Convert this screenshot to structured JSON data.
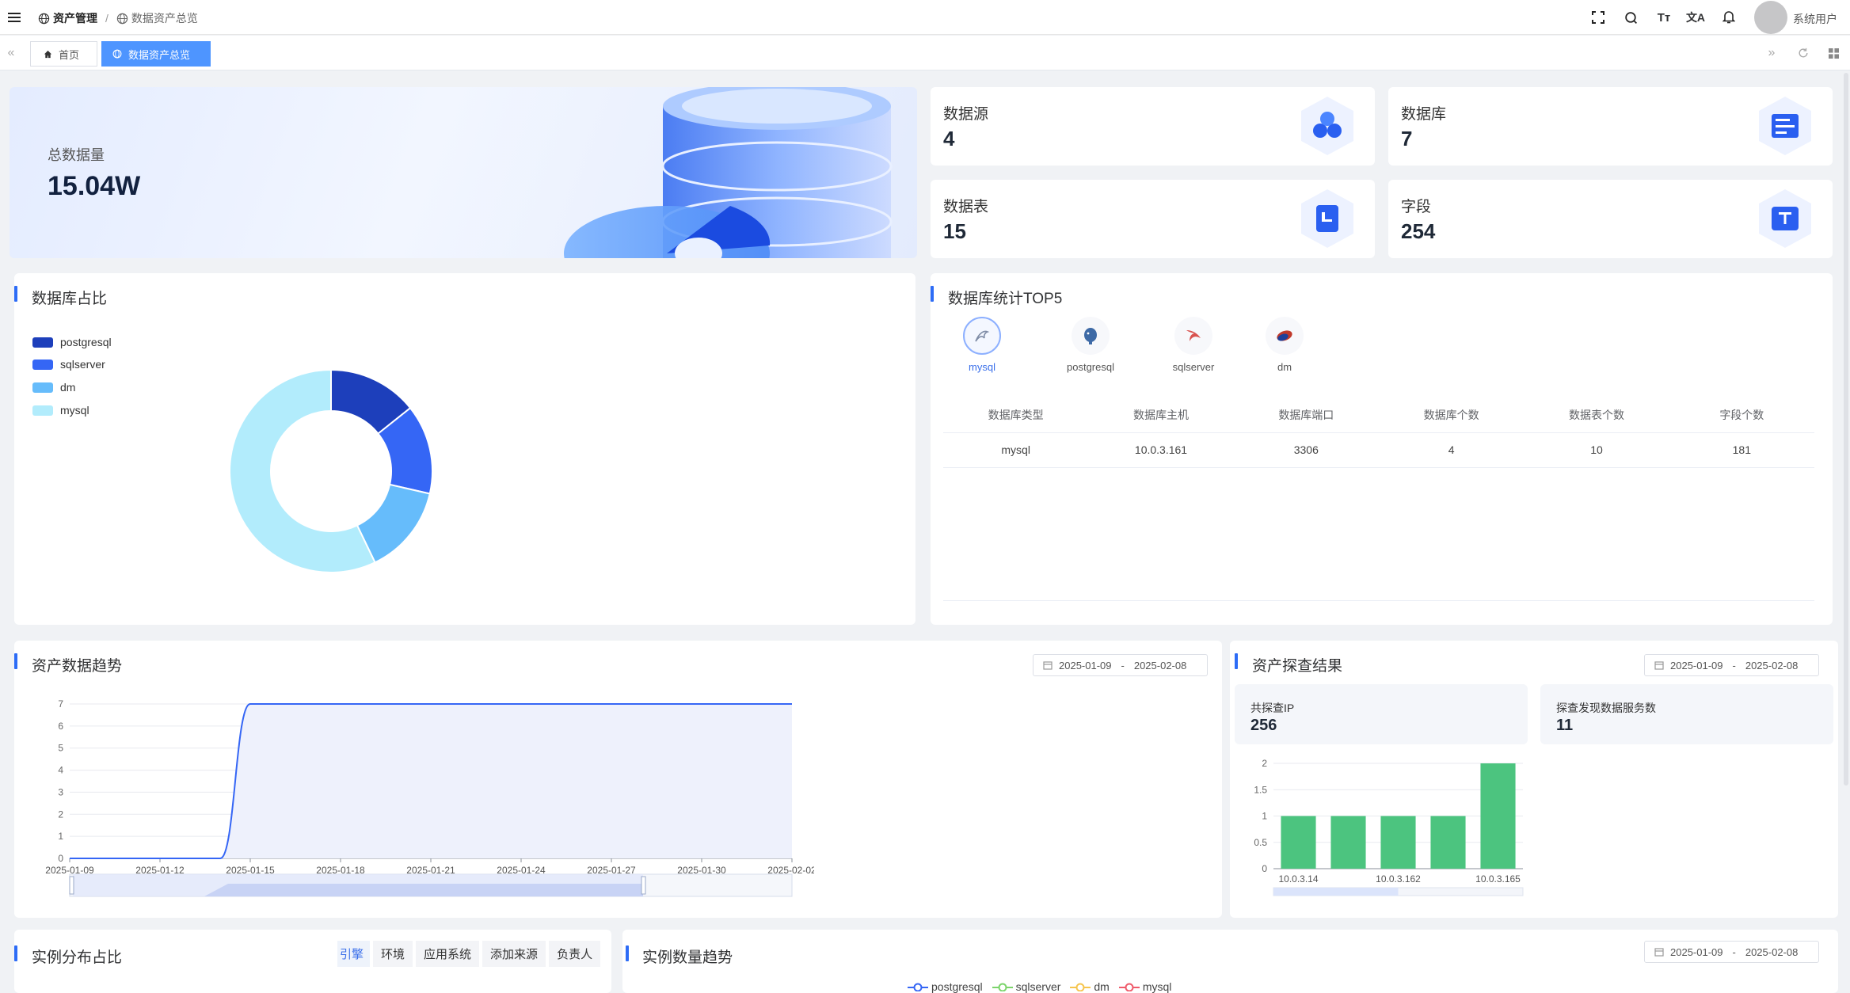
{
  "header": {
    "breadcrumb": [
      "资产管理",
      "数据资产总览"
    ],
    "breadcrumb_sep": "/",
    "user_name": "系统用户",
    "font_btn": "Tт",
    "translate_btn": "文A"
  },
  "tabs": [
    {
      "label": "首页",
      "active": false
    },
    {
      "label": "数据资产总览",
      "active": true
    }
  ],
  "banner": {
    "label": "总数据量",
    "value": "15.04W"
  },
  "stats": [
    {
      "label": "数据源",
      "value": "4"
    },
    {
      "label": "数据库",
      "value": "7"
    },
    {
      "label": "数据表",
      "value": "15"
    },
    {
      "label": "字段",
      "value": "254"
    }
  ],
  "db_share": {
    "title": "数据库占比",
    "chart_data": {
      "type": "pie",
      "categories": [
        "postgresql",
        "sqlserver",
        "dm",
        "mysql"
      ],
      "values": [
        1,
        1,
        1,
        4
      ],
      "colors": [
        "#1d3fbb",
        "#3566f5",
        "#66bcfb",
        "#b2ecfc"
      ],
      "legend": "left"
    }
  },
  "top5": {
    "title": "数据库统计TOP5",
    "db_tabs": [
      {
        "label": "mysql",
        "active": true
      },
      {
        "label": "postgresql",
        "active": false
      },
      {
        "label": "sqlserver",
        "active": false
      },
      {
        "label": "dm",
        "active": false
      }
    ],
    "table": {
      "headers": [
        "数据库类型",
        "数据库主机",
        "数据库端口",
        "数据库个数",
        "数据表个数",
        "字段个数"
      ],
      "rows": [
        [
          "mysql",
          "10.0.3.161",
          "3306",
          "4",
          "10",
          "181"
        ]
      ]
    }
  },
  "trend": {
    "title": "资产数据趋势",
    "date_start": "2025-01-09",
    "date_sep": "-",
    "date_end": "2025-02-08",
    "chart_data": {
      "type": "area",
      "x": [
        "2025-01-09",
        "2025-01-10",
        "2025-01-11",
        "2025-01-12",
        "2025-01-13",
        "2025-01-14",
        "2025-01-15",
        "2025-01-16",
        "2025-01-17",
        "2025-01-18",
        "2025-01-19",
        "2025-01-20",
        "2025-01-21",
        "2025-01-22",
        "2025-01-23",
        "2025-01-24",
        "2025-01-25",
        "2025-01-26",
        "2025-01-27",
        "2025-01-28",
        "2025-01-29",
        "2025-01-30",
        "2025-01-31",
        "2025-02-01",
        "2025-02-02"
      ],
      "values": [
        0,
        0,
        0,
        0,
        0,
        0,
        7,
        7,
        7,
        7,
        7,
        7,
        7,
        7,
        7,
        7,
        7,
        7,
        7,
        7,
        7,
        7,
        7,
        7,
        7
      ],
      "xticks": [
        "2025-01-09",
        "2025-01-12",
        "2025-01-15",
        "2025-01-18",
        "2025-01-21",
        "2025-01-24",
        "2025-01-27",
        "2025-01-30",
        "2025-02-02"
      ],
      "ylim": [
        0,
        7
      ],
      "yticks": [
        "0",
        "1",
        "2",
        "3",
        "4",
        "5",
        "6",
        "7"
      ],
      "color": "#3566f5"
    }
  },
  "probe": {
    "title": "资产探查结果",
    "date_start": "2025-01-09",
    "date_sep": "-",
    "date_end": "2025-02-08",
    "cards": [
      {
        "label": "共探查IP",
        "value": "256"
      },
      {
        "label": "探查发现数据服务数",
        "value": "11"
      }
    ],
    "chart_data": {
      "type": "bar",
      "values": [
        1,
        1,
        1,
        1,
        2
      ],
      "xticks": [
        "10.0.3.14",
        "10.0.3.162",
        "10.0.3.165"
      ],
      "yticks": [
        "0",
        "0.5",
        "1",
        "1.5",
        "2"
      ],
      "ylim": [
        0,
        2
      ],
      "color": "#4cc47f"
    }
  },
  "instances": {
    "title": "实例分布占比",
    "tabs": [
      "引擎",
      "环境",
      "应用系统",
      "添加来源",
      "负责人"
    ]
  },
  "instance_count": {
    "title": "实例数量趋势",
    "date_start": "2025-01-09",
    "date_sep": "-",
    "date_end": "2025-02-08",
    "legend": [
      {
        "name": "postgresql",
        "color": "#3566f5"
      },
      {
        "name": "sqlserver",
        "color": "#7bd46a"
      },
      {
        "name": "dm",
        "color": "#f6c54e"
      },
      {
        "name": "mysql",
        "color": "#ef5b6b"
      }
    ]
  }
}
